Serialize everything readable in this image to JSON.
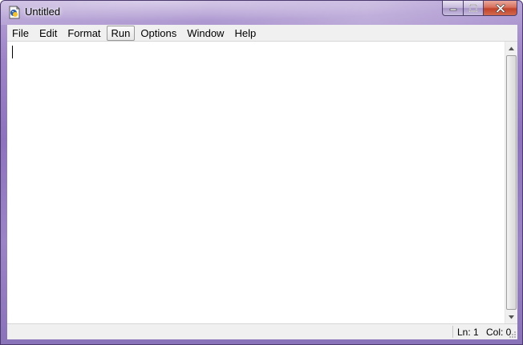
{
  "window": {
    "title": "Untitled",
    "app_icon": "idle-python-icon",
    "caption_buttons": [
      "minimize-icon",
      "maximize-icon",
      "close-icon"
    ]
  },
  "menu": {
    "items": [
      "File",
      "Edit",
      "Format",
      "Run",
      "Options",
      "Window",
      "Help"
    ],
    "active": "Run"
  },
  "editor": {
    "content": ""
  },
  "status": {
    "line": "Ln: 1",
    "column": "Col: 0"
  },
  "colors": {
    "frame": "#9c83c6",
    "menu_bg": "#f0f0f0",
    "editor_bg": "#ffffff",
    "close_button": "#c1432b"
  }
}
